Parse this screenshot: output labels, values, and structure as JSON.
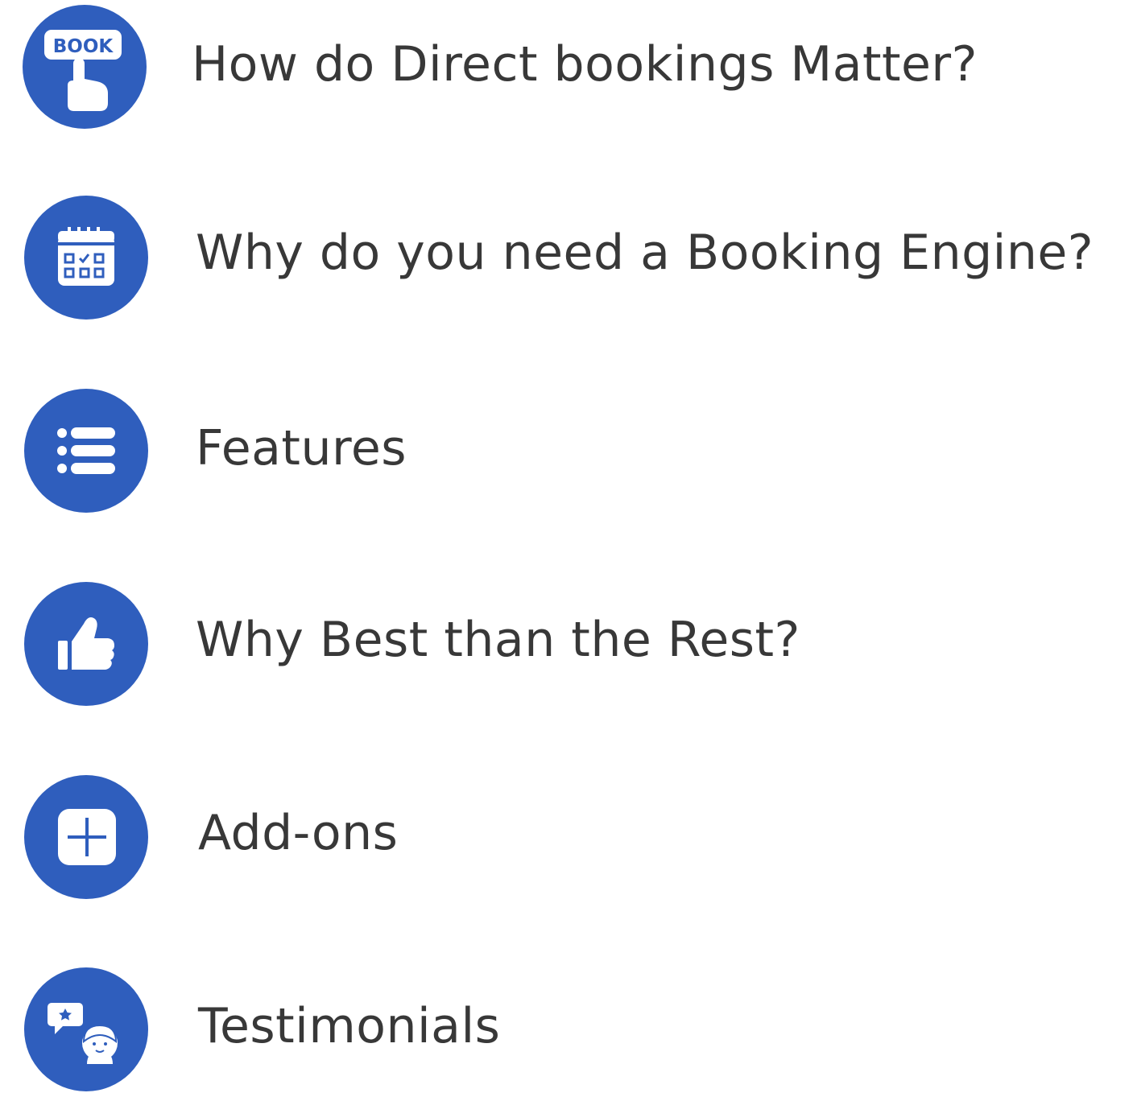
{
  "brand": {
    "accent": "#2f5ebd",
    "text_color": "#383838"
  },
  "menu": [
    {
      "label": "How do Direct bookings Matter?",
      "icon": "book-tap-icon",
      "icon_text": "BOOK"
    },
    {
      "label": "Why do you need a Booking Engine?",
      "icon": "calendar-check-icon"
    },
    {
      "label": "Features",
      "icon": "list-icon"
    },
    {
      "label": "Why Best than the Rest?",
      "icon": "thumbs-up-icon"
    },
    {
      "label": "Add-ons",
      "icon": "plus-square-icon"
    },
    {
      "label": "Testimonials",
      "icon": "testimonial-user-star-icon"
    }
  ]
}
